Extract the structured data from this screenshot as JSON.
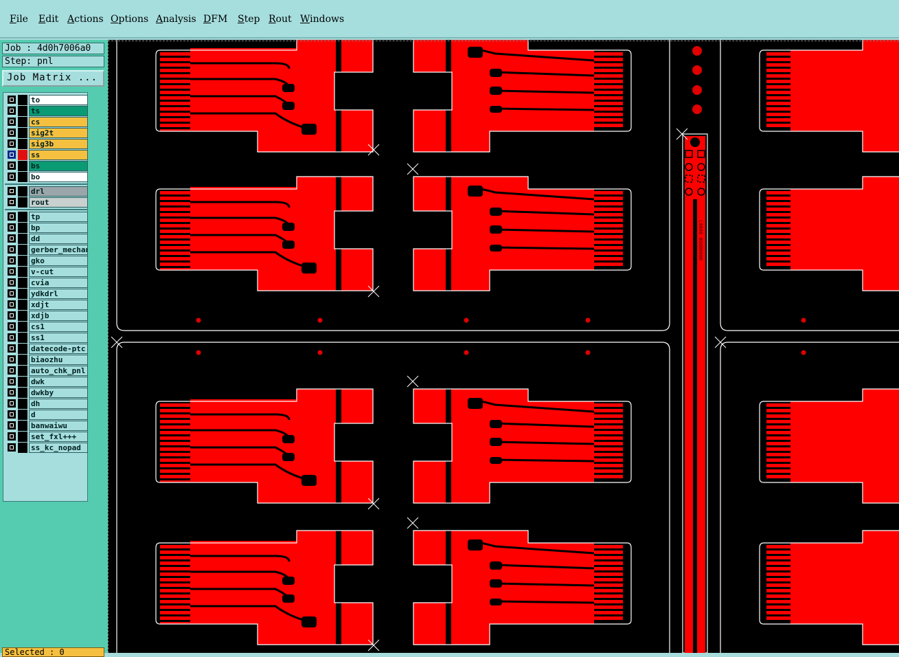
{
  "menu": [
    "File",
    "Edit",
    "Actions",
    "Options",
    "Analysis",
    "DFM",
    "Step",
    "Rout",
    "Windows"
  ],
  "job_label": "Job : 4d0h7006a0",
  "step_label": "Step: pnl",
  "job_matrix_label": "Job Matrix ...",
  "selected_label": "Selected : 0",
  "layer_groups": [
    [
      {
        "name": "to",
        "color": "#ffffff",
        "active": false
      },
      {
        "name": "ts",
        "color": "#0a9a74",
        "active": false
      },
      {
        "name": "cs",
        "color": "#f5c040",
        "active": false
      },
      {
        "name": "sig2t",
        "color": "#f5c040",
        "active": false
      },
      {
        "name": "sig3b",
        "color": "#f5c040",
        "active": false
      },
      {
        "name": "ss",
        "color": "#f5c040",
        "active": true,
        "swatch": "#e01010"
      },
      {
        "name": "bs",
        "color": "#0a9a74",
        "active": false
      },
      {
        "name": "bo",
        "color": "#ffffff",
        "active": false
      }
    ],
    [
      {
        "name": "drl",
        "color": "#9aa6aa",
        "active": false
      },
      {
        "name": "rout",
        "color": "#c8d0d0",
        "active": false
      }
    ],
    [
      {
        "name": "tp",
        "color": "#a6dede",
        "active": false
      },
      {
        "name": "bp",
        "color": "#a6dede",
        "active": false
      },
      {
        "name": "dd",
        "color": "#a6dede",
        "active": false
      },
      {
        "name": "gerber_mechanical",
        "color": "#a6dede",
        "active": false
      },
      {
        "name": "gko",
        "color": "#a6dede",
        "active": false
      },
      {
        "name": "v-cut",
        "color": "#a6dede",
        "active": false
      },
      {
        "name": "cvia",
        "color": "#a6dede",
        "active": false
      },
      {
        "name": "ydkdrl",
        "color": "#a6dede",
        "active": false
      },
      {
        "name": "xdjt",
        "color": "#a6dede",
        "active": false
      },
      {
        "name": "xdjb",
        "color": "#a6dede",
        "active": false
      },
      {
        "name": "cs1",
        "color": "#a6dede",
        "active": false
      },
      {
        "name": "ss1",
        "color": "#a6dede",
        "active": false
      },
      {
        "name": "datecode-ptc",
        "color": "#a6dede",
        "active": false
      },
      {
        "name": "biaozhu",
        "color": "#a6dede",
        "active": false
      },
      {
        "name": "auto_chk_pnl",
        "color": "#a6dede",
        "active": false
      },
      {
        "name": "dwk",
        "color": "#a6dede",
        "active": false
      },
      {
        "name": "dwkby",
        "color": "#a6dede",
        "active": false
      },
      {
        "name": "dh",
        "color": "#a6dede",
        "active": false
      },
      {
        "name": "d",
        "color": "#a6dede",
        "active": false
      },
      {
        "name": "banwaiwu",
        "color": "#a6dede",
        "active": false
      },
      {
        "name": "set_fxl+++",
        "color": "#a6dede",
        "active": false
      },
      {
        "name": "ss_kc_nopad",
        "color": "#a6dede",
        "active": false
      }
    ]
  ],
  "colors": {
    "copper": "#ff0000",
    "background": "#000000",
    "outline": "#ffffff",
    "panel": "#55ccaf",
    "menu": "#a6dede"
  }
}
